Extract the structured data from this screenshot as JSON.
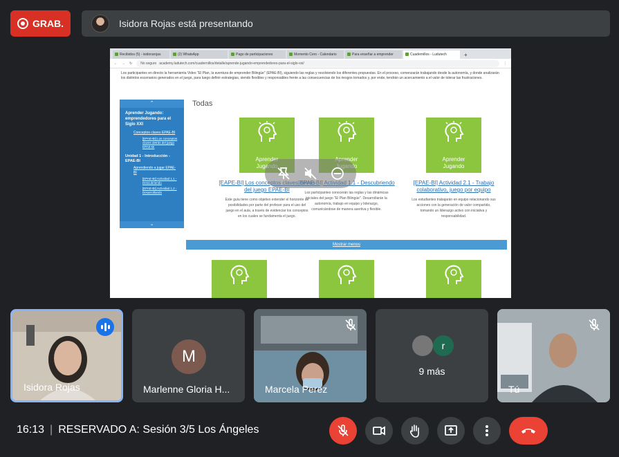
{
  "top": {
    "record_label": "GRAB.",
    "presenting_text": "Isidora Rojas está presentando"
  },
  "browser": {
    "tabs": [
      {
        "label": "Recibidos (5) - isidorarojas"
      },
      {
        "label": "(2) WhatsApp"
      },
      {
        "label": "Pago de participaciones"
      },
      {
        "label": "Momento Cero - Calendario"
      },
      {
        "label": "Para enseñar a emprender"
      },
      {
        "label": "Cuadernillos - Ludutech"
      }
    ],
    "url_security": "No seguro",
    "url": "academy.ludutech.com/cuadernillos/detalle/aprende-jugando-emprendedores-para-el-siglo-xxi/"
  },
  "page": {
    "intro_text": "Los participantes en directo la herramienta Video \"El Plan, la aventura de emprender Bilingüe\" (EPAE-BI), siguiendo las reglas y resolviendo los diferentes propuestas. En el proceso, comenzarán trabajando desde la autonomía, y donde analizarán los distintos escenarios generados en el juego, para luego definir estrategias, siendo flexibles y responsables frente a las consecuencias de los riesgos tomados y, por ende, tendrán un acercamiento a el valor de tolerar las frustraciones.",
    "sidebar": {
      "title": "Aprender Jugando: emprendedores para el Siglo XXI",
      "item1": "Conceptos claves EPAE-BI",
      "item1_sub": "[EPAE-BI] Los conceptos claves detrás del juego EPAE-BI",
      "unit1": "Unidad 1 - Introducción - EPAE-BI",
      "item2": "Aprendiendo a jugar EPAE-BI",
      "item2_sub1": "[EPAE-BI] Actividad 1.1 - Descubriendo",
      "item2_sub2": "[EPAE-BI] Actividad 1.2 - Desarrollando"
    },
    "section_title": "Todas",
    "thumb_label_line1": "Aprender",
    "thumb_label_line2": "Jugando",
    "cards": [
      {
        "title": "[EAPE-BI] Los conceptos claves detrás del juego EPAE-BI",
        "desc": "Este guía tiene como objetivo extender el horizonte de posibilidades por parte del profesor para el uso del juego en el aula, a través de evidenciar los conceptos en los cuales se fundamenta el juego."
      },
      {
        "title": "[EPAE-BI] Actividad 1.1 - Descubriendo",
        "desc": "Los participantes conocerán las reglas y las dinámicas iniciales del juego \"El Plan Bilingüe\". Desarrollarán la autonomía, trabajo en equipo y liderazgo, comunicándose de manera asertiva y flexible."
      },
      {
        "title": "[EPAE-BI] Actividad 2.1 - Trabajo colaborativo, juego por equipo",
        "desc": "Los estudiantes trabajarán en equipo relacionando sus acciones con la generación de valor compartido, tomando un liderazgo activo con iniciativa y responsabilidad."
      }
    ],
    "show_more": "Mostrar menos"
  },
  "participants": [
    {
      "name": "Isidora Rojas"
    },
    {
      "name": "Marlenne Gloria H...",
      "initial": "M"
    },
    {
      "name": "Marcela Perez"
    },
    {
      "more_label": "9 más",
      "initial": "r"
    },
    {
      "name": "Tú"
    }
  ],
  "bottom": {
    "time": "16:13",
    "meeting_title": "RESERVADO A: Sesión 3/5 Los Ángeles"
  },
  "colors": {
    "background": "#202124",
    "record_red": "#d93025",
    "hangup_red": "#ea4335",
    "speaking_blue": "#1a73e8",
    "card_green": "#8cc63f",
    "sidebar_blue": "#2d7fc1"
  }
}
